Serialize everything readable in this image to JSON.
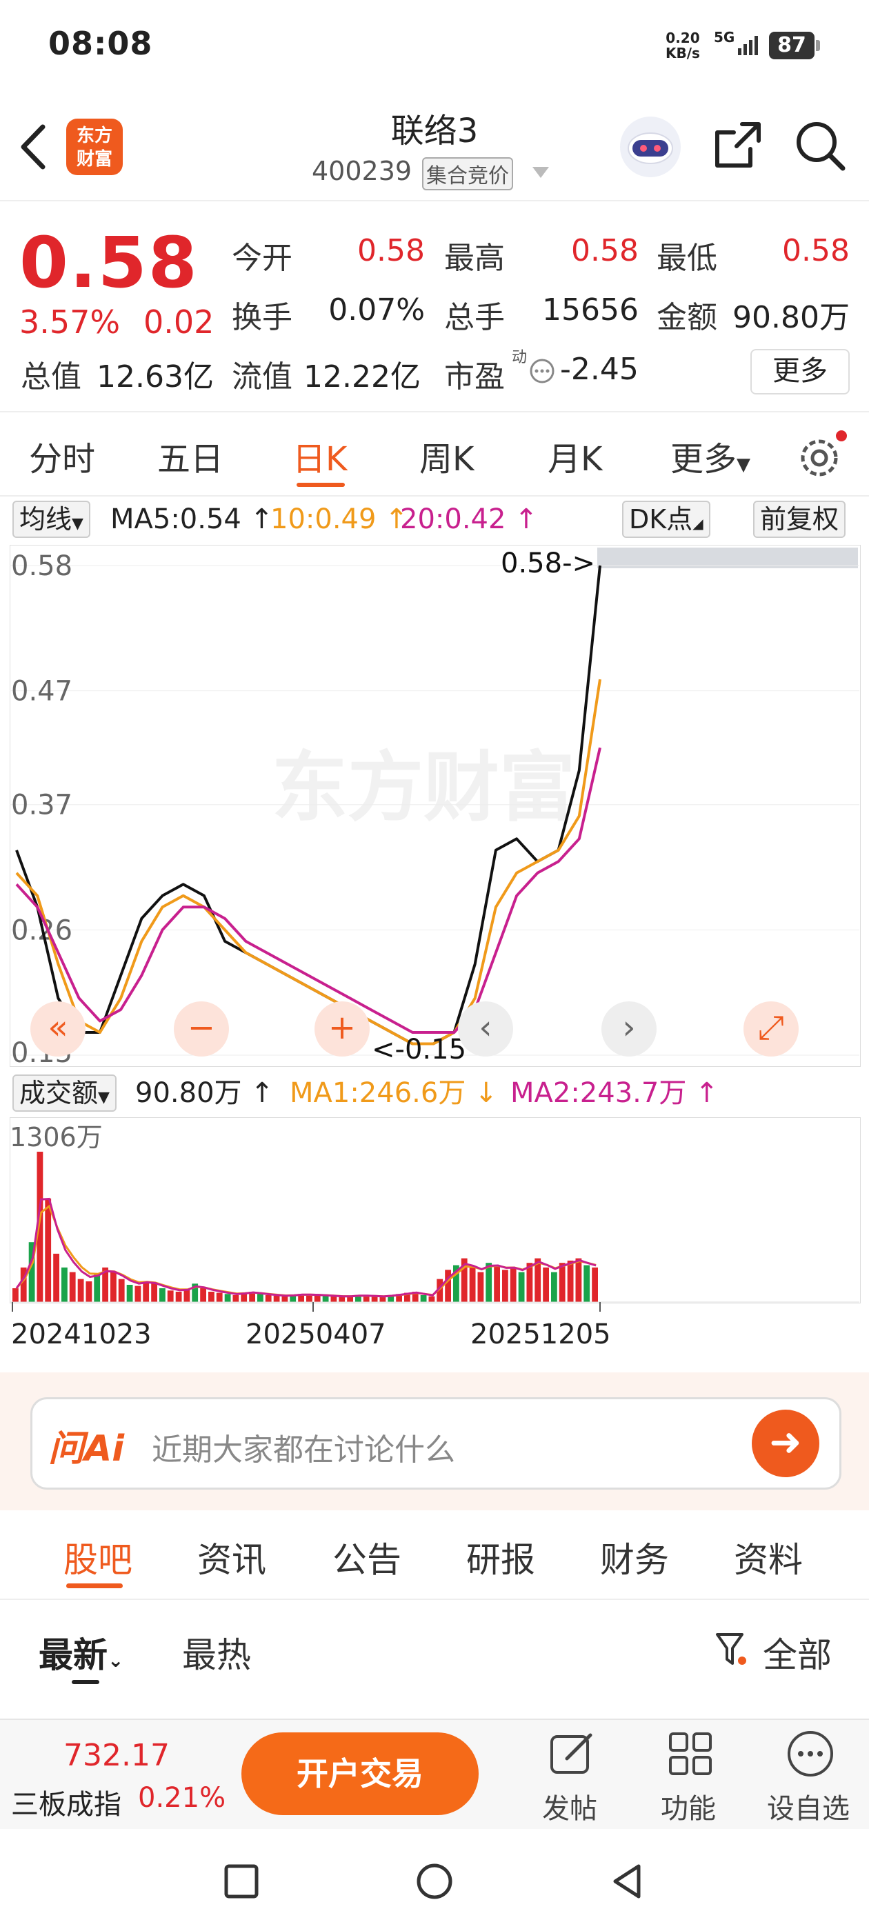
{
  "status": {
    "time": "08:08",
    "net_speed": "0.20",
    "net_unit": "KB/s",
    "network": "5G",
    "battery": "87"
  },
  "header": {
    "logo": [
      "东方",
      "财富"
    ],
    "title": "联络3",
    "code": "400239",
    "badge": "集合竞价"
  },
  "quote": {
    "price": "0.58",
    "change_pct": "3.57%",
    "change": "0.02",
    "fields": [
      {
        "label": "今开",
        "value": "0.58",
        "red": true
      },
      {
        "label": "最高",
        "value": "0.58",
        "red": true
      },
      {
        "label": "最低",
        "value": "0.58",
        "red": true
      },
      {
        "label": "换手",
        "value": "0.07%",
        "red": false
      },
      {
        "label": "总手",
        "value": "15656",
        "red": false
      },
      {
        "label": "金额",
        "value": "90.80万",
        "red": false
      }
    ],
    "total_value_label": "总值",
    "total_value": "12.63亿",
    "float_value_label": "流值",
    "float_value": "12.22亿",
    "pe_label": "市盈",
    "pe_sup": "动",
    "pe_value": "-2.45",
    "more": "更多"
  },
  "chart_tabs": [
    "分时",
    "五日",
    "日K",
    "周K",
    "月K",
    "更多"
  ],
  "ma_row": {
    "toggle": "均线",
    "ma5": "MA5:0.54",
    "ma10": "10:0.49",
    "ma20": "20:0.42",
    "dk": "DK点",
    "adjust": "前复权"
  },
  "colors": {
    "accent": "#ef5a1e",
    "up": "#e0262b",
    "down": "#1aa34a",
    "ma5": "#111111",
    "ma10": "#f09a1a",
    "ma20": "#c8208e"
  },
  "chart_data": [
    {
      "type": "line",
      "yticks": [
        "0.58",
        "0.47",
        "0.37",
        "0.26",
        "0.15"
      ],
      "ylim": [
        0.15,
        0.58
      ],
      "annotation_high": "0.58->",
      "annotation_low": "<-0.15",
      "series": [
        {
          "name": "MA5",
          "values": [
            0.33,
            0.28,
            0.2,
            0.17,
            0.17,
            0.22,
            0.27,
            0.29,
            0.3,
            0.29,
            0.25,
            0.24,
            0.23,
            0.22,
            0.21,
            0.2,
            0.19,
            0.18,
            0.17,
            0.16,
            0.16,
            0.17,
            0.23,
            0.33,
            0.34,
            0.32,
            0.33,
            0.4,
            0.58
          ]
        },
        {
          "name": "10",
          "values": [
            0.31,
            0.29,
            0.23,
            0.18,
            0.17,
            0.2,
            0.25,
            0.28,
            0.29,
            0.28,
            0.26,
            0.24,
            0.23,
            0.22,
            0.21,
            0.2,
            0.19,
            0.18,
            0.17,
            0.16,
            0.16,
            0.17,
            0.2,
            0.28,
            0.31,
            0.32,
            0.33,
            0.36,
            0.48
          ]
        },
        {
          "name": "20",
          "values": [
            0.3,
            0.28,
            0.24,
            0.2,
            0.18,
            0.19,
            0.22,
            0.26,
            0.28,
            0.28,
            0.27,
            0.25,
            0.24,
            0.23,
            0.22,
            0.21,
            0.2,
            0.19,
            0.18,
            0.17,
            0.17,
            0.17,
            0.19,
            0.24,
            0.29,
            0.31,
            0.32,
            0.34,
            0.42
          ]
        }
      ]
    },
    {
      "type": "bar",
      "title": "成交额",
      "current": "90.80万",
      "ma1": "MA1:246.6万",
      "ma2": "MA2:243.7万",
      "ymax_label": "1306万",
      "xticks": [
        "20241023",
        "20250407",
        "20251205"
      ],
      "values": [
        120,
        300,
        520,
        1306,
        900,
        420,
        300,
        260,
        200,
        180,
        240,
        300,
        260,
        200,
        150,
        140,
        180,
        160,
        120,
        100,
        90,
        110,
        160,
        120,
        90,
        80,
        70,
        60,
        80,
        90,
        70,
        60,
        55,
        50,
        60,
        70,
        65,
        60,
        55,
        50,
        45,
        50,
        60,
        55,
        50,
        45,
        60,
        70,
        80,
        90,
        60,
        50,
        200,
        280,
        320,
        380,
        300,
        260,
        340,
        320,
        280,
        300,
        260,
        340,
        380,
        300,
        260,
        340,
        360,
        380,
        320,
        300
      ]
    }
  ],
  "ai": {
    "logo": "问Ai",
    "placeholder": "近期大家都在讨论什么"
  },
  "sections": [
    "股吧",
    "资讯",
    "公告",
    "研报",
    "财务",
    "资料"
  ],
  "filters": {
    "latest": "最新",
    "hot": "最热",
    "all": "全部"
  },
  "bottom": {
    "index_value": "732.17",
    "index_name": "三板成指",
    "index_pct": "0.21%",
    "trade": "开户交易",
    "post": "发帖",
    "func": "功能",
    "watch": "设自选"
  }
}
